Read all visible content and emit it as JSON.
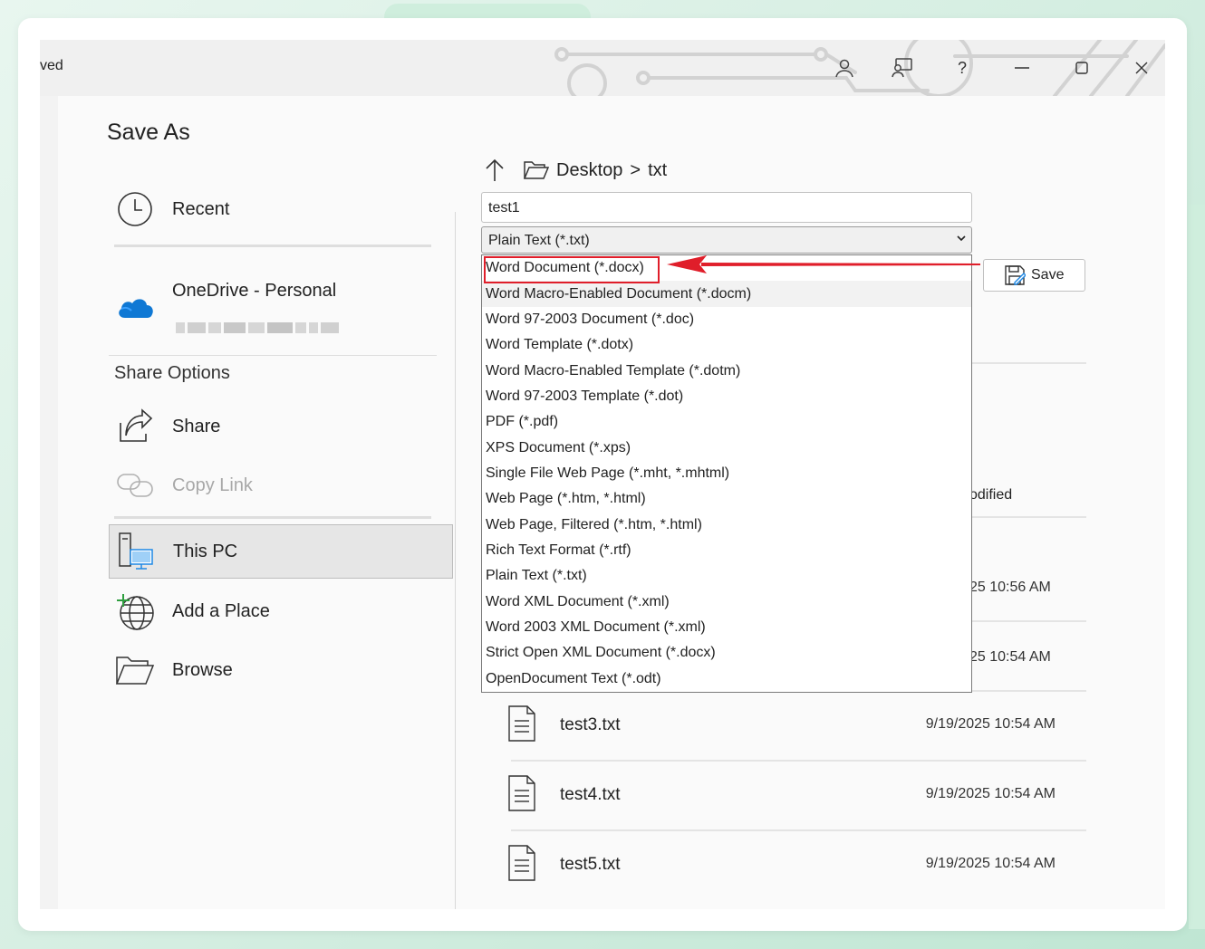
{
  "titlebar": {
    "partial_title": "ved",
    "help_label": "?"
  },
  "page_title": "Save As",
  "nav": {
    "recent": "Recent",
    "onedrive": "OneDrive - Personal",
    "share_options": "Share Options",
    "share": "Share",
    "copy_link": "Copy Link",
    "this_pc": "This PC",
    "add_place": "Add a Place",
    "browse": "Browse"
  },
  "path": {
    "folder": "Desktop",
    "separator": ">",
    "subfolder": "txt"
  },
  "filename_value": "test1",
  "filetype_selected": "Plain Text (*.txt)",
  "filetype_options": [
    "Word Document (*.docx)",
    "Word Macro-Enabled Document (*.docm)",
    "Word 97-2003 Document (*.doc)",
    "Word Template (*.dotx)",
    "Word Macro-Enabled Template (*.dotm)",
    "Word 97-2003 Template (*.dot)",
    "PDF (*.pdf)",
    "XPS Document (*.xps)",
    "Single File Web Page (*.mht, *.mhtml)",
    "Web Page (*.htm, *.html)",
    "Web Page, Filtered (*.htm, *.html)",
    "Rich Text Format (*.rtf)",
    "Plain Text (*.txt)",
    "Word XML Document (*.xml)",
    "Word 2003 XML Document (*.xml)",
    "Strict Open XML Document (*.docx)",
    "OpenDocument Text (*.odt)"
  ],
  "save_label": "Save",
  "column_partial": "odified",
  "partial_dates": [
    "25 10:56 AM",
    "25 10:54 AM"
  ],
  "files": [
    {
      "name": "test3.txt",
      "date": "9/19/2025 10:54 AM"
    },
    {
      "name": "test4.txt",
      "date": "9/19/2025 10:54 AM"
    },
    {
      "name": "test5.txt",
      "date": "9/19/2025 10:54 AM"
    }
  ],
  "colors": {
    "highlight": "#e01e2a",
    "onedrive": "#0f78d4",
    "monitor": "#1e88e5"
  }
}
